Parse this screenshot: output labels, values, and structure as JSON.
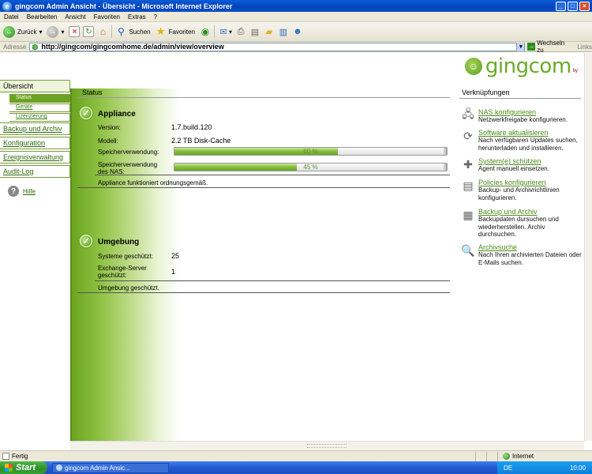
{
  "window": {
    "title": "gingcom Admin Ansicht - Übersicht - Microsoft Internet Explorer",
    "controls": {
      "minimize": "_",
      "maximize": "□",
      "close": "×"
    }
  },
  "menu": [
    "Datei",
    "Bearbeiten",
    "Ansicht",
    "Favoriten",
    "Extras",
    "?"
  ],
  "toolbar": {
    "back": "Zurück",
    "search": "Suchen",
    "favorites": "Favoriten"
  },
  "address": {
    "label": "Adresse",
    "url": "http://gingcom/gingcomhome.de/admin/view/overview",
    "go": "Wechseln zu",
    "links": "Links"
  },
  "logo": {
    "word": "gingcom",
    "by": "by"
  },
  "nav": {
    "main_overview": "Übersicht",
    "sub": [
      "Status",
      "Geräte",
      "Lizenzierung"
    ],
    "backup": "Backup und Archiv",
    "config": "Konfiguration",
    "events": "Ereignisverwaltung",
    "audit": "Audit-Log",
    "help": "Hilfe"
  },
  "status": {
    "header": "Status",
    "appliance": {
      "title": "Appliance",
      "version_label": "Version:",
      "version_value": "1.7.build.120",
      "model_label": "Modell:",
      "model_value": "2.2 TB Disk-Cache",
      "storage_label": "Speicherverwendung:",
      "storage_percent": 60,
      "storage_text": "60 %",
      "nas_label": "Speicherverwendung des NAS:",
      "nas_percent": 45,
      "nas_text": "45 %",
      "note": "Appliance funktioniert ordnungsgemäß."
    },
    "environment": {
      "title": "Umgebung",
      "systems_label": "Systeme geschützt:",
      "systems_value": "25",
      "exchange_label": "Exchange-Server geschützt:",
      "exchange_value": "1",
      "note": "Umgebung geschützt."
    }
  },
  "links": {
    "header": "Verknüpfungen",
    "items": [
      {
        "title": "NAS konfigurieren",
        "desc": "Netzwerkfreigabe konfigurieren.",
        "icon": "nas-icon"
      },
      {
        "title": "Software aktualisieren",
        "desc": "Nach verfügbaren Updates suchen, herunterladen und installieren.",
        "icon": "refresh-icon"
      },
      {
        "title": "System(e) schützen",
        "desc": "Agent manuell einsetzen.",
        "icon": "shield-plus-icon"
      },
      {
        "title": "Policies konfigurieren",
        "desc": "Backup- und Archivrichtlinien konfigurieren.",
        "icon": "policy-icon"
      },
      {
        "title": "Backup und Archiv",
        "desc": "Backupdaten dursuchen und wiederherstellen. Archiv durchsuchen.",
        "icon": "archive-icon"
      },
      {
        "title": "Archivsuche",
        "desc": "Nach Ihren archivierten Dateien oder E-Mails suchen.",
        "icon": "search-icon"
      }
    ]
  },
  "statusbar": {
    "done": "Fertig",
    "zone": "Internet"
  },
  "taskbar": {
    "start": "Start",
    "task": "gingcom Admin Ansic...",
    "lang": "DE",
    "time": "10:00"
  }
}
